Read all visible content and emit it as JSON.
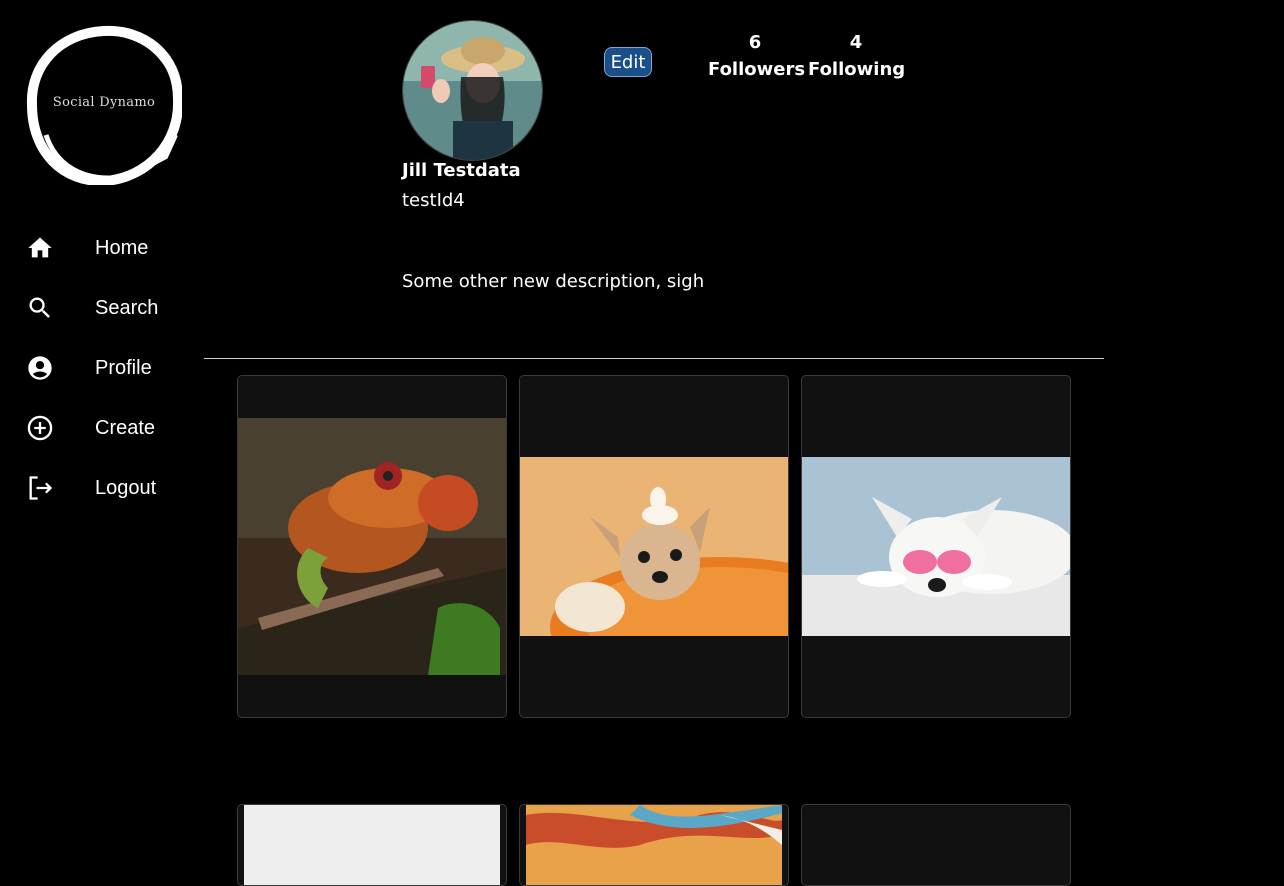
{
  "app": {
    "logo_text": "Social Dynamo"
  },
  "nav": {
    "items": [
      {
        "label": "Home",
        "icon": "home-icon"
      },
      {
        "label": "Search",
        "icon": "search-icon"
      },
      {
        "label": "Profile",
        "icon": "account-circle-icon"
      },
      {
        "label": "Create",
        "icon": "add-circle-icon"
      },
      {
        "label": "Logout",
        "icon": "logout-icon"
      }
    ]
  },
  "profile": {
    "name": "Jill Testdata",
    "handle": "testId4",
    "description": "Some other new description, sigh",
    "edit_label": "Edit",
    "followers_count": "6",
    "followers_label": "Followers",
    "following_count": "4",
    "following_label": "Following"
  },
  "posts": [
    {
      "subject": "chameleon"
    },
    {
      "subject": "chihuahua"
    },
    {
      "subject": "white dog with pink glasses"
    },
    {
      "subject": "white image"
    },
    {
      "subject": "marble paint"
    },
    {
      "subject": "empty"
    }
  ],
  "colors": {
    "background": "#000000",
    "card": "#111111",
    "edit_button": "#1b4f8a"
  }
}
